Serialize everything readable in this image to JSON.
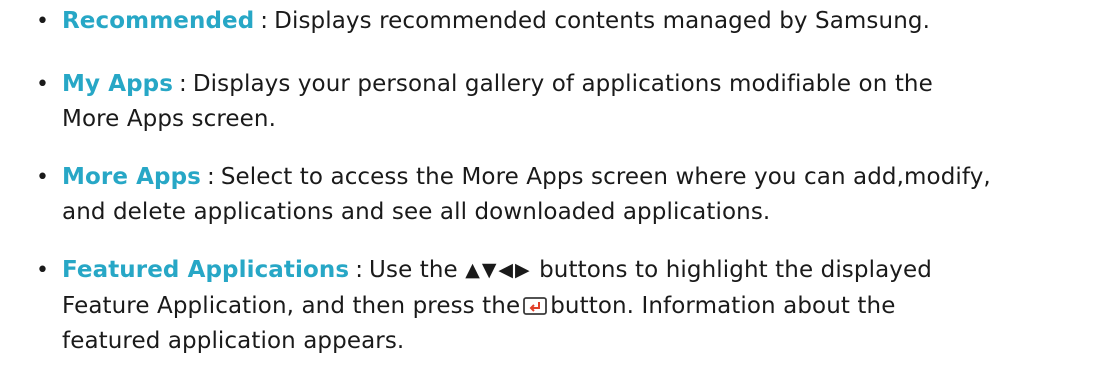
{
  "items": [
    {
      "term": "Recommended",
      "colon": ":",
      "lines": [
        "Displays recommended contents managed by Samsung."
      ]
    },
    {
      "term": "My Apps",
      "colon": ":",
      "lines": [
        "Displays your personal gallery of applications modifiable on the",
        "More Apps screen."
      ]
    },
    {
      "term": "More Apps",
      "colon": ":",
      "lines": [
        "Select to access the More Apps screen where you can add,modify,",
        "and delete applications and see all downloaded applications."
      ]
    },
    {
      "term": "Featured Applications",
      "colon": ":",
      "line1_before_arrows": "Use the",
      "arrows": "▲▼◀▶",
      "line1_after_arrows": "buttons to highlight the displayed",
      "line2_before_icon": "Feature Application, and then press the",
      "line2_after_icon": "button. Information about the",
      "line3": "featured application appears."
    }
  ],
  "bullet_char": "•",
  "colors": {
    "term": "#27a7c6",
    "text": "#1a1a1a",
    "icon_border": "#3a3a3a",
    "icon_arrow": "#e0402a"
  },
  "icons": {
    "enter_button": "enter-icon"
  }
}
